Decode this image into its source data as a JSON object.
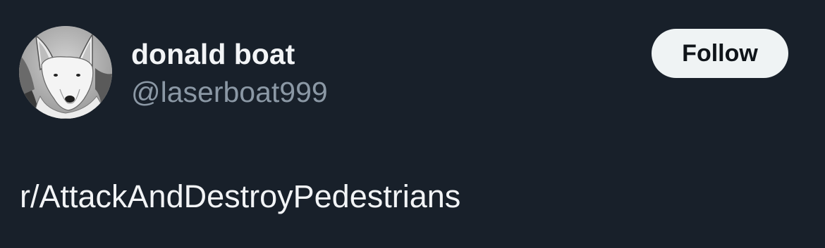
{
  "user": {
    "display_name": "donald boat",
    "handle": "@laserboat999",
    "avatar_icon": "bull-terrier-avatar"
  },
  "actions": {
    "follow_label": "Follow"
  },
  "tweet": {
    "text": "r/AttackAndDestroyPedestrians"
  },
  "colors": {
    "background": "#18202a",
    "name_text": "#f2f4f6",
    "handle_text": "#8b98a5",
    "button_bg": "#eff3f4",
    "button_text": "#0f1419"
  }
}
